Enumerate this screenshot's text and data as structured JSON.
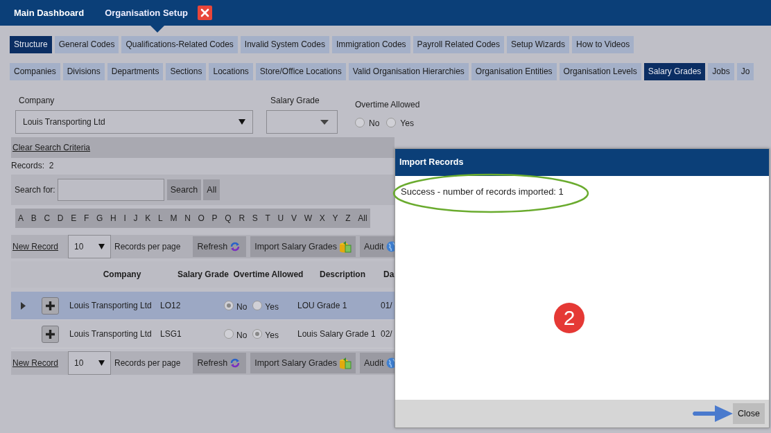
{
  "top_tabs": [
    {
      "label": "Main Dashboard",
      "selected": false,
      "closable": false
    },
    {
      "label": "Organisation Setup",
      "selected": true,
      "closable": true
    }
  ],
  "category_tabs": [
    {
      "label": "Structure",
      "selected": true
    },
    {
      "label": "General Codes",
      "selected": false
    },
    {
      "label": "Qualifications-Related Codes",
      "selected": false
    },
    {
      "label": "Invalid System Codes",
      "selected": false
    },
    {
      "label": "Immigration Codes",
      "selected": false
    },
    {
      "label": "Payroll Related Codes",
      "selected": false
    },
    {
      "label": "Setup Wizards",
      "selected": false
    },
    {
      "label": "How to Videos",
      "selected": false
    }
  ],
  "sub_tabs": [
    {
      "label": "Companies",
      "selected": false
    },
    {
      "label": "Divisions",
      "selected": false
    },
    {
      "label": "Departments",
      "selected": false
    },
    {
      "label": "Sections",
      "selected": false
    },
    {
      "label": "Locations",
      "selected": false
    },
    {
      "label": "Store/Office Locations",
      "selected": false
    },
    {
      "label": "Valid Organisation Hierarchies",
      "selected": false
    },
    {
      "label": "Organisation Entities",
      "selected": false
    },
    {
      "label": "Organisation Levels",
      "selected": false
    },
    {
      "label": "Salary Grades",
      "selected": true
    },
    {
      "label": "Jobs",
      "selected": false
    },
    {
      "label": "Jo",
      "selected": false
    }
  ],
  "filters": {
    "company": {
      "label": "Company",
      "value": "Louis Transporting Ltd"
    },
    "salary_grade": {
      "label": "Salary Grade"
    },
    "overtime": {
      "label": "Overtime Allowed",
      "options": [
        {
          "label": "No",
          "selected": false
        },
        {
          "label": "Yes",
          "selected": false
        }
      ]
    }
  },
  "clear_link": "Clear Search Criteria",
  "records_count": "Records:  2",
  "search": {
    "label": "Search for:",
    "buttons": [
      "Search",
      "All"
    ]
  },
  "letters": [
    "A",
    "B",
    "C",
    "D",
    "E",
    "F",
    "G",
    "H",
    "I",
    "J",
    "K",
    "L",
    "M",
    "N",
    "O",
    "P",
    "Q",
    "R",
    "S",
    "T",
    "U",
    "V",
    "W",
    "X",
    "Y",
    "Z",
    "All"
  ],
  "toolbars": [
    {
      "new_record": "New Record",
      "page_size": "10",
      "per_page": "Records per page",
      "buttons": [
        "Refresh",
        "Import Salary Grades",
        "Audit"
      ]
    },
    {
      "new_record": "New Record",
      "page_size": "10",
      "per_page": "Records per page",
      "buttons": [
        "Refresh",
        "Import Salary Grades",
        "Audit"
      ]
    }
  ],
  "table": {
    "columns": [
      "Company",
      "Salary Grade",
      "Overtime Allowed",
      "Description",
      "Da"
    ],
    "rows": [
      {
        "selected": true,
        "expandable": true,
        "company": "Louis Transporting Ltd",
        "grade": "LO12",
        "overtime": [
          {
            "label": "No",
            "selected": true
          },
          {
            "label": "Yes",
            "selected": false
          }
        ],
        "description": "LOU Grade 1",
        "date": "01/"
      },
      {
        "selected": false,
        "expandable": false,
        "company": "Louis Transporting Ltd",
        "grade": "LSG1",
        "overtime": [
          {
            "label": "No",
            "selected": false
          },
          {
            "label": "Yes",
            "selected": true
          }
        ],
        "description": "Louis Salary Grade 1",
        "date": "02/"
      }
    ]
  },
  "dialog": {
    "title": "Import Records",
    "message": "Success - number of records imported: 1",
    "close": "Close"
  },
  "step_marker": "2"
}
